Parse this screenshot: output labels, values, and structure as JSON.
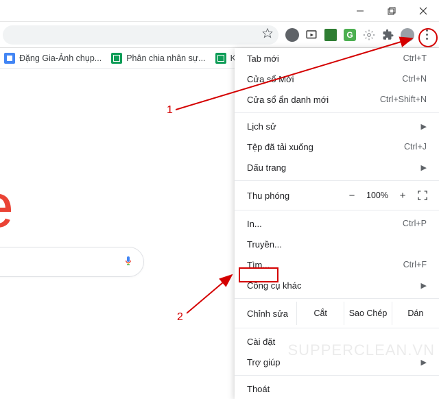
{
  "window_controls": {
    "minimize": "—",
    "restore": "❐",
    "close": "×"
  },
  "toolbar": {
    "icons": [
      "profile",
      "cast",
      "green-sq",
      "grammarly",
      "gear",
      "extensions",
      "avatar",
      "menu"
    ]
  },
  "bookmarks": [
    {
      "icon": "doc",
      "label": "Đặng Gia-Ảnh chụp..."
    },
    {
      "icon": "sheet",
      "label": "Phân chia nhân sự..."
    },
    {
      "icon": "sheet",
      "label": "KPI thá"
    }
  ],
  "logo_fragment": "e",
  "menu": {
    "new_tab": "Tab mới",
    "new_tab_sc": "Ctrl+T",
    "new_window": "Cửa sổ Mới",
    "new_window_sc": "Ctrl+N",
    "incognito": "Cửa sổ ẩn danh mới",
    "incognito_sc": "Ctrl+Shift+N",
    "history": "Lịch sử",
    "downloads": "Tệp đã tải xuống",
    "downloads_sc": "Ctrl+J",
    "bookmarks": "Dấu trang",
    "zoom": "Thu phóng",
    "zoom_out": "−",
    "zoom_value": "100%",
    "zoom_in": "+",
    "print": "In...",
    "print_sc": "Ctrl+P",
    "cast": "Truyền...",
    "find": "Tìm...",
    "find_sc": "Ctrl+F",
    "more_tools": "Công cụ khác",
    "edit": "Chỉnh sửa",
    "cut": "Cắt",
    "copy": "Sao Chép",
    "paste": "Dán",
    "settings": "Cài đặt",
    "help": "Trợ giúp",
    "exit": "Thoát"
  },
  "annotations": {
    "one": "1",
    "two": "2"
  },
  "watermark": "SUPPERCLEAN.VN"
}
